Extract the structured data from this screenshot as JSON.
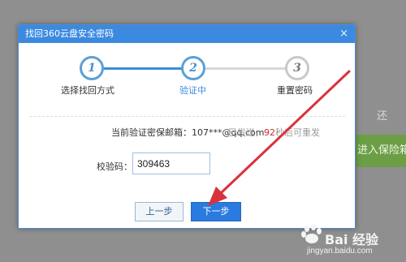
{
  "background": {
    "side_text": "还",
    "green_button": "进入保险箱"
  },
  "dialog": {
    "title": "找回360云盘安全密码",
    "close_glyph": "×",
    "steps": [
      {
        "number": "1",
        "label": "选择找回方式",
        "state": "done"
      },
      {
        "number": "2",
        "label": "验证中",
        "state": "active"
      },
      {
        "number": "3",
        "label": "重置密码",
        "state": "pending"
      }
    ],
    "email_label": "当前验证密保邮箱：",
    "email_value": "107***@qq.com",
    "sent_prefix": "已发送，",
    "sent_seconds": "92",
    "sent_suffix": "秒后可重发",
    "code_label": "校验码：",
    "code_value": "309463",
    "prev_button": "上一步",
    "next_button": "下一步"
  },
  "watermark": {
    "title": "Bai 经验",
    "url": "jingyan.baidu.com"
  },
  "colors": {
    "accent": "#3c8ae0",
    "arrow": "#d9323a",
    "countdown": "#cc2a2a"
  }
}
